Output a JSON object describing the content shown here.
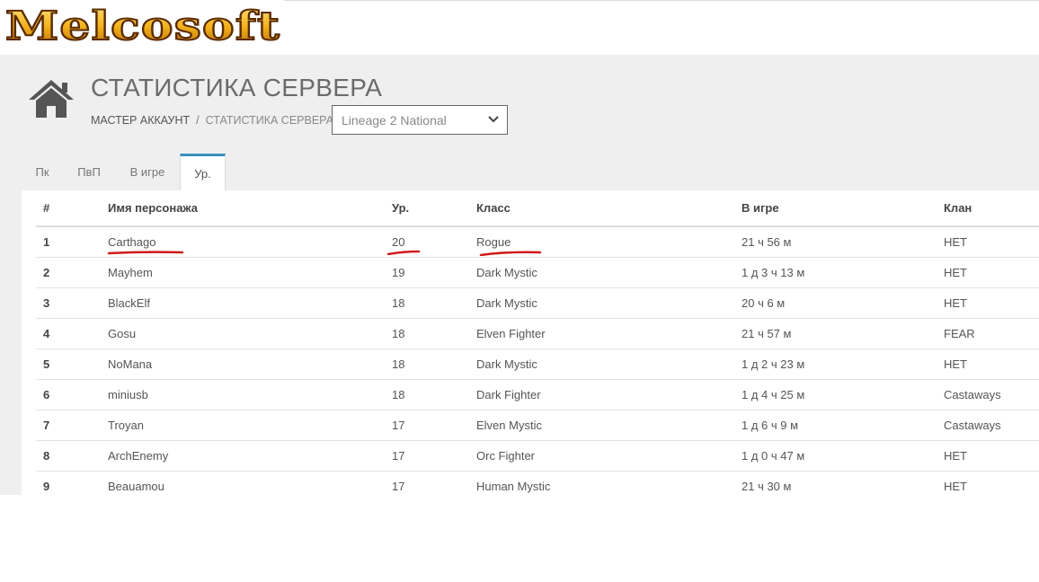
{
  "logo": {
    "text": "Melcosoft"
  },
  "header": {
    "title": "СТАТИСТИКА СЕРВЕРА",
    "breadcrumb": {
      "root": "МАСТЕР АККАУНТ",
      "separator": "/",
      "current": "СТАТИСТИКА СЕРВЕРА"
    },
    "server_select": {
      "value": "Lineage 2 National"
    }
  },
  "tabs": [
    {
      "label": "Пк",
      "active": false
    },
    {
      "label": "ПвП",
      "active": false
    },
    {
      "label": "В игре",
      "active": false
    },
    {
      "label": "Ур.",
      "active": true
    }
  ],
  "table": {
    "columns": [
      "#",
      "Имя персонажа",
      "Ур.",
      "Класс",
      "В игре",
      "Клан"
    ],
    "rows": [
      [
        "1",
        "Carthago",
        "20",
        "Rogue",
        "21 ч 56 м",
        "НЕТ"
      ],
      [
        "2",
        "Mayhem",
        "19",
        "Dark Mystic",
        "1 д 3 ч 13 м",
        "НЕТ"
      ],
      [
        "3",
        "BlackElf",
        "18",
        "Dark Mystic",
        "20 ч 6 м",
        "НЕТ"
      ],
      [
        "4",
        "Gosu",
        "18",
        "Elven Fighter",
        "21 ч 57 м",
        "FEAR"
      ],
      [
        "5",
        "NoMana",
        "18",
        "Dark Mystic",
        "1 д 2 ч 23 м",
        "НЕТ"
      ],
      [
        "6",
        "miniusb",
        "18",
        "Dark Fighter",
        "1 д 4 ч 25 м",
        "Castaways"
      ],
      [
        "7",
        "Troyan",
        "17",
        "Elven Mystic",
        "1 д 6 ч 9 м",
        "Castaways"
      ],
      [
        "8",
        "ArchEnemy",
        "17",
        "Orc Fighter",
        "1 д 0 ч 47 м",
        "НЕТ"
      ],
      [
        "9",
        "Beauamou",
        "17",
        "Human Mystic",
        "21 ч 30 м",
        "НЕТ"
      ]
    ]
  },
  "colors": {
    "panel_bg": "#efefef",
    "tab_accent": "#3b8ec2",
    "annotation_red": "#d01a1a",
    "logo_gold": "#f2b21c"
  },
  "icons": {
    "home": "home-icon",
    "select_arrow": "chevron-down-icon"
  }
}
